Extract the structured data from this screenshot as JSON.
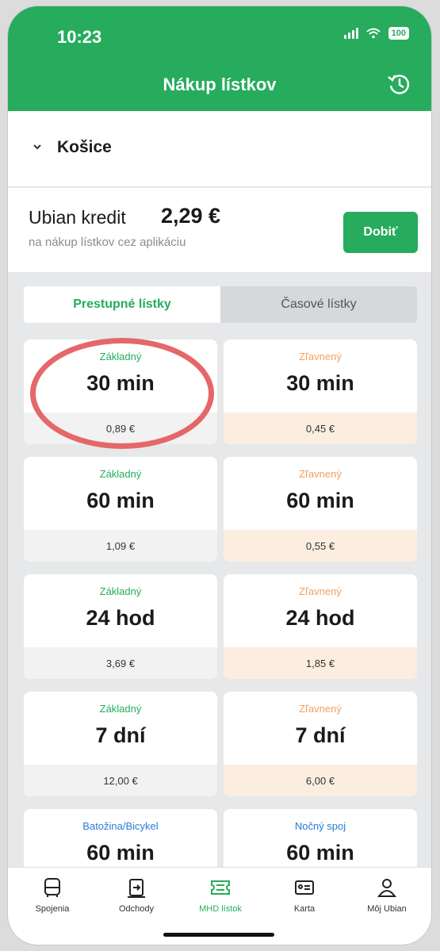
{
  "status": {
    "time": "10:23",
    "battery": "100"
  },
  "header": {
    "title": "Nákup lístkov",
    "history_icon": "history-icon"
  },
  "city": {
    "name": "Košice"
  },
  "credit": {
    "label": "Ubian kredit",
    "amount": "2,29 €",
    "subtitle": "na nákup lístkov cez aplikáciu",
    "topup_label": "Dobiť"
  },
  "tabs": [
    {
      "label": "Prestupné lístky",
      "active": true
    },
    {
      "label": "Časové lístky",
      "active": false
    }
  ],
  "tickets": [
    {
      "category": "Základný",
      "duration": "30 min",
      "price": "0,89 €"
    },
    {
      "category": "Zľavnený",
      "duration": "30 min",
      "price": "0,45 €"
    },
    {
      "category": "Základný",
      "duration": "60 min",
      "price": "1,09 €"
    },
    {
      "category": "Zľavnený",
      "duration": "60 min",
      "price": "0,55 €"
    },
    {
      "category": "Základný",
      "duration": "24 hod",
      "price": "3,69 €"
    },
    {
      "category": "Zľavnený",
      "duration": "24 hod",
      "price": "1,85 €"
    },
    {
      "category": "Základný",
      "duration": "7 dní",
      "price": "12,00 €"
    },
    {
      "category": "Zľavnený",
      "duration": "7 dní",
      "price": "6,00 €"
    },
    {
      "category": "Batožina/Bicykel",
      "duration": "60 min",
      "price": ""
    },
    {
      "category": "Nočný spoj",
      "duration": "60 min",
      "price": ""
    }
  ],
  "nav": [
    {
      "label": "Spojenia",
      "icon": "bus-icon"
    },
    {
      "label": "Odchody",
      "icon": "departures-icon"
    },
    {
      "label": "MHD lístok",
      "icon": "ticket-icon",
      "active": true
    },
    {
      "label": "Karta",
      "icon": "card-icon"
    },
    {
      "label": "Môj Ubian",
      "icon": "user-icon"
    }
  ],
  "colors": {
    "brand_green": "#26ac5c",
    "reduced_orange": "#f0a060",
    "highlight_red": "#e5676a",
    "extra_blue": "#2a7bd6"
  }
}
